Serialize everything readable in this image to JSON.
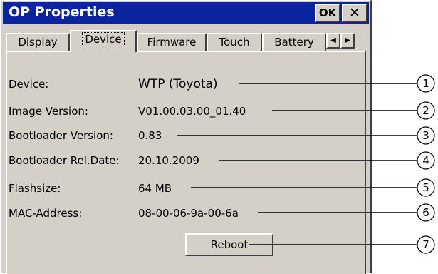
{
  "window": {
    "title": "OP Properties",
    "ok_label": "OK",
    "close_label": "✕"
  },
  "tabs": [
    {
      "label": "Display",
      "active": false
    },
    {
      "label": "Device",
      "active": true
    },
    {
      "label": "Firmware",
      "active": false
    },
    {
      "label": "Touch",
      "active": false
    },
    {
      "label": "Battery",
      "active": false
    }
  ],
  "tab_scroll": {
    "left": "◀",
    "right": "▶"
  },
  "properties": [
    {
      "label": "Device:",
      "value": "WTP (Toyota)"
    },
    {
      "label": "Image Version:",
      "value": "V01.00.03.00_01.40"
    },
    {
      "label": "Bootloader Version:",
      "value": "0.83"
    },
    {
      "label": "Bootloader Rel.Date:",
      "value": "20.10.2009"
    },
    {
      "label": "Flashsize:",
      "value": "64 MB"
    },
    {
      "label": "MAC-Address:",
      "value": "08-00-06-9a-00-6a"
    }
  ],
  "reboot_label": "Reboot",
  "callouts": [
    "1",
    "2",
    "3",
    "4",
    "5",
    "6",
    "7"
  ]
}
